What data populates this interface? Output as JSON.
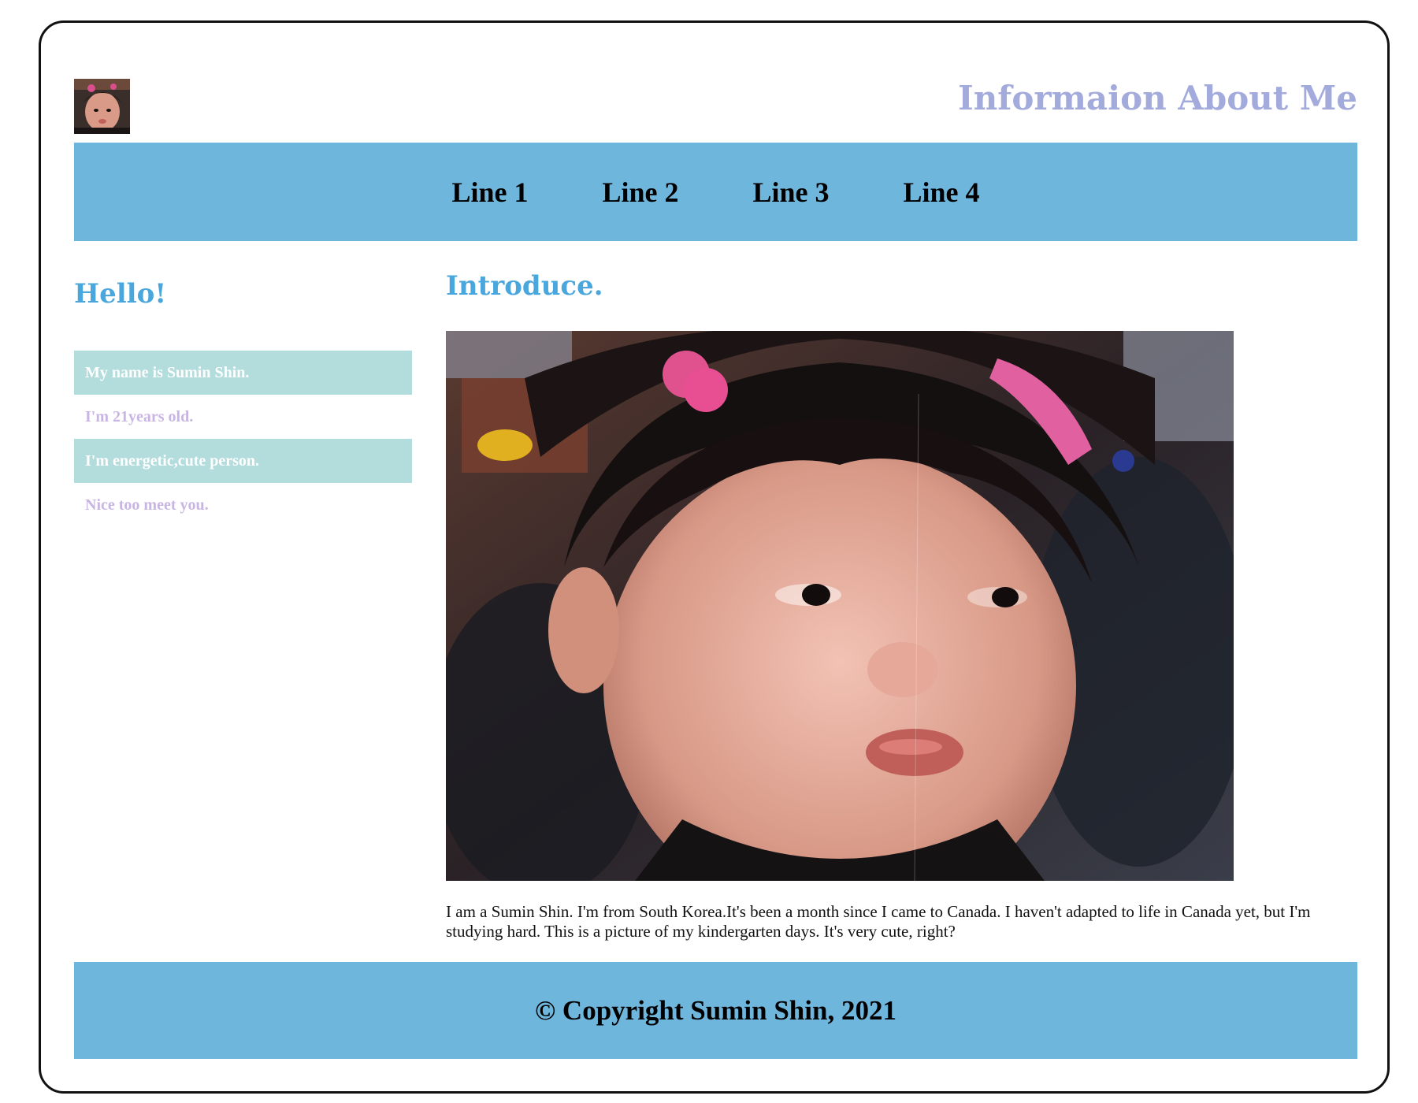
{
  "header": {
    "title": "Informaion About Me"
  },
  "nav": {
    "items": [
      {
        "label": "Line 1"
      },
      {
        "label": "Line 2"
      },
      {
        "label": "Line 3"
      },
      {
        "label": "Line 4"
      }
    ]
  },
  "sidebar": {
    "heading": "Hello!",
    "items": [
      {
        "text": "My name is Sumin Shin."
      },
      {
        "text": "I'm 21years old."
      },
      {
        "text": "I'm energetic,cute person."
      },
      {
        "text": "Nice too meet you."
      }
    ]
  },
  "main": {
    "heading": "Introduce.",
    "paragraph": "I am a Sumin Shin. I'm from South Korea.It's been a month since I came to Canada. I haven't adapted to life in Canada yet, but I'm studying hard. This is a picture of my kindergarten days. It's very cute, right?"
  },
  "footer": {
    "copyright": "© Copyright Sumin Shin, 2021"
  },
  "colors": {
    "nav_background": "#6fb6dc",
    "title": "#a3aadc",
    "heading": "#4aa7dd",
    "list_filled_background": "#b3dcdc",
    "list_plain_text": "#c9b5e3"
  }
}
